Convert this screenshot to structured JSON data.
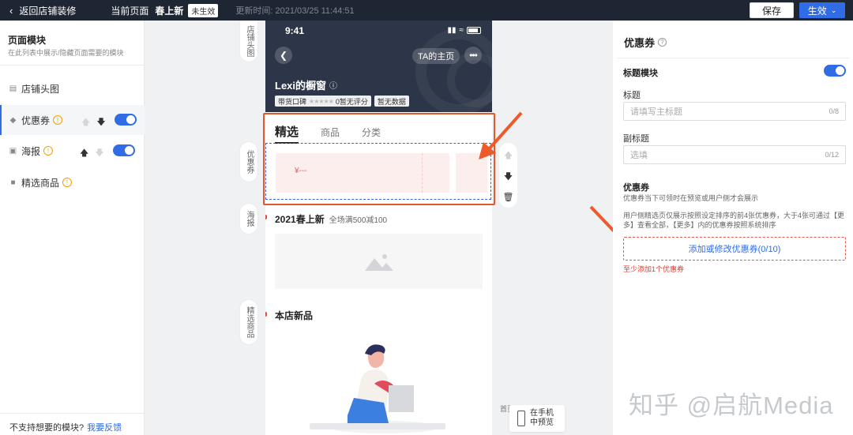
{
  "topbar": {
    "back_label": "返回店铺装修",
    "current_label": "当前页面",
    "page_name": "春上新",
    "status_badge": "未生效",
    "updated": "更新时间: 2021/03/25 11:44:51",
    "save_label": "保存",
    "apply_label": "生效"
  },
  "left_panel": {
    "title": "页面模块",
    "subtitle": "在此列表中展示/隐藏页面需要的模块",
    "modules": [
      {
        "label": "店铺头图",
        "icon": "shop-icon"
      },
      {
        "label": "优惠券",
        "icon": "tag-icon",
        "warning": true,
        "toggle_on": true
      },
      {
        "label": "海报",
        "icon": "image-icon",
        "warning": true,
        "toggle_on": true
      },
      {
        "label": "精选商品",
        "icon": "bag-icon",
        "warning": true
      }
    ],
    "footer_text": "不支持想要的模块?",
    "feedback_link": "我要反馈"
  },
  "side_tabs": {
    "header": "店铺头图",
    "coupon": "优惠券",
    "poster": "海报",
    "featured": "精选商品"
  },
  "phone": {
    "time": "9:41",
    "ta_home": "TA的主页",
    "shop_name": "Lexi的橱窗",
    "reputation_label": "带货口碑",
    "reputation_value": "0暂无评分",
    "no_data": "暂无数据",
    "tabs": [
      "精选",
      "商品",
      "分类"
    ],
    "coupon_price": "¥---",
    "section1_title": "2021春上新",
    "section1_sub": "全场满500减100",
    "section2_title": "本店新品"
  },
  "preview": {
    "label_line1": "在手机",
    "label_line2": "中预览",
    "first_label": "首页"
  },
  "right_panel": {
    "title": "优惠券",
    "title_module": "标题模块",
    "title_label": "标题",
    "title_placeholder": "请填写主标题",
    "title_count": "0/8",
    "subtitle_label": "副标题",
    "subtitle_placeholder": "选填",
    "subtitle_count": "0/12",
    "coupon_label": "优惠券",
    "coupon_note1": "优惠券当下可领时在预览或用户侧才会展示",
    "coupon_note2": "用户侧精选页仅展示按照设定排序的前4张优惠券，大于4张可通过【更多】查看全部，【更多】内的优惠券按照系统排序",
    "add_button": "添加或修改优惠券(0/10)",
    "error": "至少添加1个优惠券"
  },
  "watermark": "知乎 @启航Media",
  "colors": {
    "primary": "#2f6ce5",
    "highlight": "#e4572e",
    "topbar": "#1f2633"
  }
}
